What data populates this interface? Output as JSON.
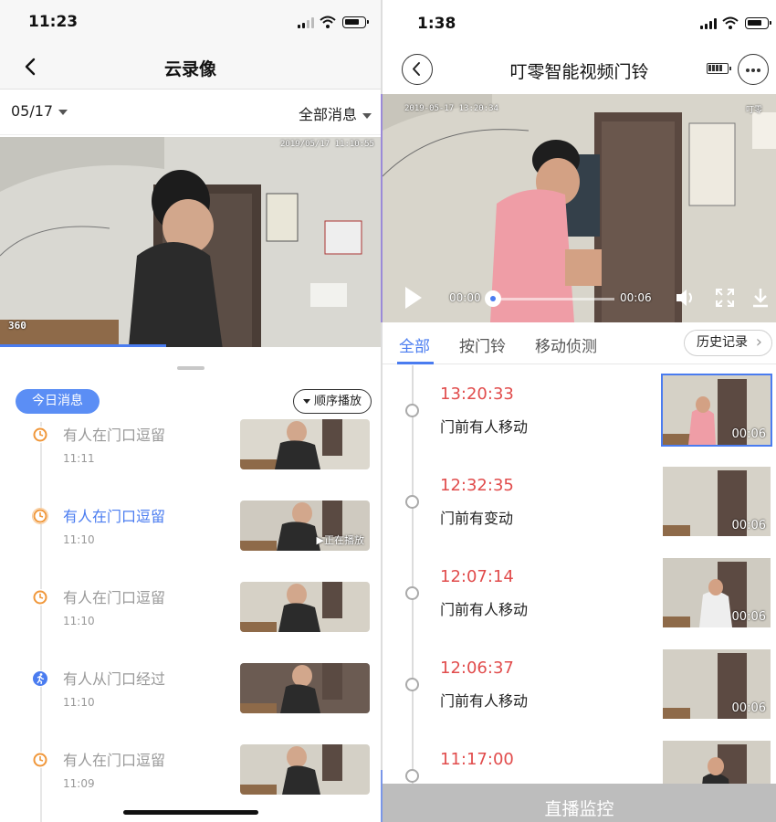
{
  "left": {
    "status_time": "11:23",
    "nav_title": "云录像",
    "filter": {
      "date": "05/17",
      "message_filter": "全部消息"
    },
    "video_timestamp": "2019/05/17 11:10:55",
    "video_logo": "360",
    "today_badge": "今日消息",
    "order_button": "顺序播放",
    "events": [
      {
        "title": "有人在门口逗留",
        "time": "11:11",
        "icon": "clock-icon",
        "color": "#f0973a",
        "active": false,
        "thumb_text": ""
      },
      {
        "title": "有人在门口逗留",
        "time": "11:10",
        "icon": "clock-icon",
        "color": "#f0973a",
        "active": true,
        "thumb_text": "▶正在播放"
      },
      {
        "title": "有人在门口逗留",
        "time": "11:10",
        "icon": "clock-icon",
        "color": "#f0973a",
        "active": false,
        "thumb_text": ""
      },
      {
        "title": "有人从门口经过",
        "time": "11:10",
        "icon": "walking-person-icon",
        "color": "#4a7cf0",
        "active": false,
        "thumb_text": ""
      },
      {
        "title": "有人在门口逗留",
        "time": "11:09",
        "icon": "clock-icon",
        "color": "#f0973a",
        "active": false,
        "thumb_text": ""
      }
    ]
  },
  "right": {
    "status_time": "1:38",
    "nav_title": "叮零智能视频门铃",
    "video_timestamp": "2019-05-17 13:20:34",
    "video_watermark": "叮零",
    "player": {
      "current": "00:00",
      "duration": "00:06",
      "progress": 0.0
    },
    "tabs": [
      {
        "label": "全部",
        "active": true
      },
      {
        "label": "按门铃",
        "active": false
      },
      {
        "label": "移动侦测",
        "active": false
      }
    ],
    "history_button": "历史记录",
    "events": [
      {
        "time": "13:20:33",
        "desc": "门前有人移动",
        "duration": "00:06",
        "selected": true
      },
      {
        "time": "12:32:35",
        "desc": "门前有变动",
        "duration": "00:06",
        "selected": false
      },
      {
        "time": "12:07:14",
        "desc": "门前有人移动",
        "duration": "00:06",
        "selected": false
      },
      {
        "time": "12:06:37",
        "desc": "门前有人移动",
        "duration": "00:06",
        "selected": false
      },
      {
        "time": "11:17:00",
        "desc": "",
        "duration": "",
        "selected": false
      }
    ],
    "live_button": "直播监控"
  },
  "colors": {
    "accent": "#4a7cf0",
    "warning": "#f0973a",
    "event_time": "#e14c4c"
  }
}
